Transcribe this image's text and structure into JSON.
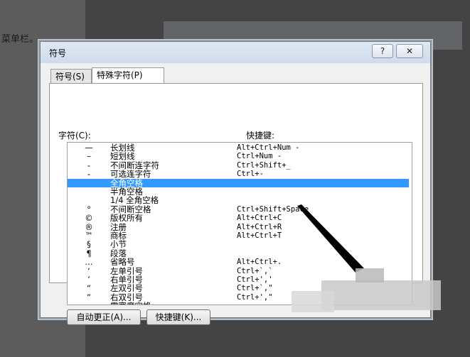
{
  "background": {
    "text": "菜单栏。"
  },
  "dialog": {
    "title": "符号",
    "help_label": "?",
    "close_label": "✕",
    "tabs": [
      {
        "label": "符号(S)"
      },
      {
        "label": "特殊字符(P)"
      }
    ],
    "columns": {
      "char": "字符(C):",
      "shortcut": "快捷键:"
    },
    "rows": [
      {
        "symbol": "—",
        "name": "长划线",
        "shortcut": "Alt+Ctrl+Num -"
      },
      {
        "symbol": "–",
        "name": "短划线",
        "shortcut": "Ctrl+Num -"
      },
      {
        "symbol": "-",
        "name": "不间断连字符",
        "shortcut": "Ctrl+Shift+_"
      },
      {
        "symbol": "-",
        "name": "可选连字符",
        "shortcut": "Ctrl+-"
      },
      {
        "symbol": "",
        "name": "全角空格",
        "shortcut": ""
      },
      {
        "symbol": "",
        "name": "半角空格",
        "shortcut": ""
      },
      {
        "symbol": "",
        "name": "1/4 全角空格",
        "shortcut": ""
      },
      {
        "symbol": "°",
        "name": "不间断空格",
        "shortcut": "Ctrl+Shift+Space"
      },
      {
        "symbol": "©",
        "name": "版权所有",
        "shortcut": "Alt+Ctrl+C"
      },
      {
        "symbol": "®",
        "name": "注册",
        "shortcut": "Alt+Ctrl+R"
      },
      {
        "symbol": "™",
        "name": "商标",
        "shortcut": "Alt+Ctrl+T"
      },
      {
        "symbol": "§",
        "name": "小节",
        "shortcut": ""
      },
      {
        "symbol": "¶",
        "name": "段落",
        "shortcut": ""
      },
      {
        "symbol": "…",
        "name": "省略号",
        "shortcut": "Alt+Ctrl+."
      },
      {
        "symbol": "‘",
        "name": "左单引号",
        "shortcut": "Ctrl+`,`"
      },
      {
        "symbol": "’",
        "name": "右单引号",
        "shortcut": "Ctrl+','"
      },
      {
        "symbol": "“",
        "name": "左双引号",
        "shortcut": "Ctrl+`,\""
      },
      {
        "symbol": "”",
        "name": "右双引号",
        "shortcut": "Ctrl+',\""
      },
      {
        "symbol": "",
        "name": "零宽度空格",
        "shortcut": ""
      }
    ],
    "selected_row": 4,
    "buttons": {
      "autocorrect": "自动更正(A)...",
      "shortcut": "快捷键(K)..."
    }
  },
  "colors": {
    "selection": "#3399ff"
  }
}
